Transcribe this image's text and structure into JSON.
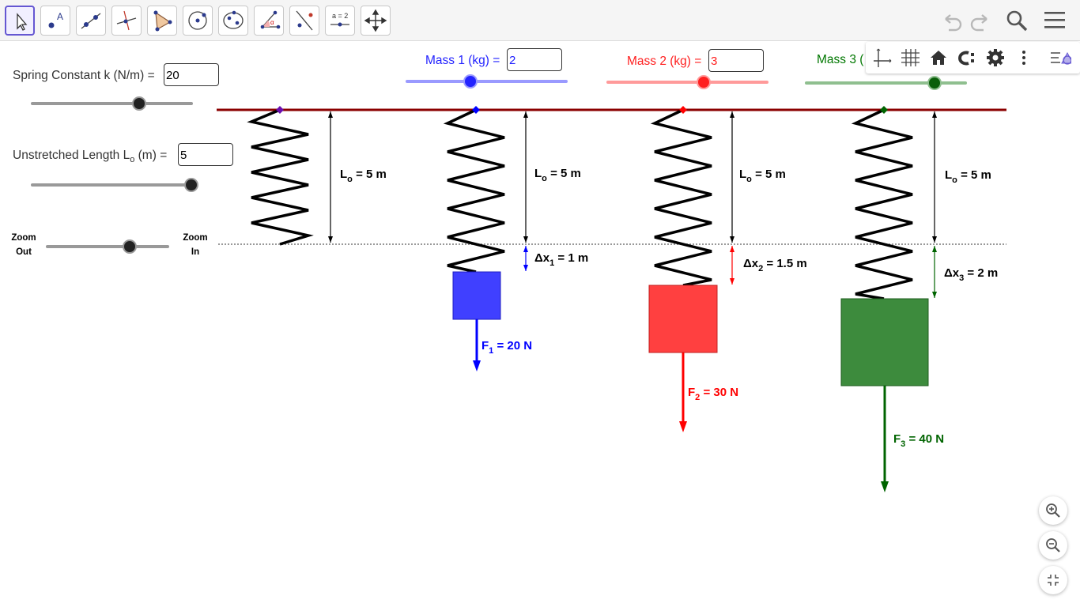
{
  "toolbar": {
    "tools": [
      {
        "name": "move-tool",
        "icon": "cursor-icon"
      },
      {
        "name": "point-tool",
        "icon": "point-icon"
      },
      {
        "name": "line-tool",
        "icon": "line-icon"
      },
      {
        "name": "perpendicular-line-tool",
        "icon": "perpendicular-icon"
      },
      {
        "name": "polygon-tool",
        "icon": "polygon-icon"
      },
      {
        "name": "circle-center-point-tool",
        "icon": "circle-icon"
      },
      {
        "name": "ellipse-tool",
        "icon": "ellipse-icon"
      },
      {
        "name": "angle-tool",
        "icon": "angle-icon"
      },
      {
        "name": "reflect-tool",
        "icon": "reflect-icon"
      },
      {
        "name": "slider-tool",
        "icon": "slider-icon",
        "label": "a = 2"
      },
      {
        "name": "move-graphics-view-tool",
        "icon": "move-view-icon"
      }
    ],
    "right_icons": [
      "undo-icon",
      "redo-icon",
      "search-icon",
      "menu-icon"
    ]
  },
  "controls": {
    "spring_constant": {
      "label": "Spring Constant k (N/m)",
      "eq": "=",
      "value": "20",
      "level": 0.67
    },
    "unstretched_length": {
      "label_main": "Unstretched Length L",
      "label_sub": "o",
      "label_unit": " (m)",
      "eq": "=",
      "value": "5",
      "level": 1.0
    },
    "zoom": {
      "out_line1": "Zoom",
      "out_line2": "Out",
      "in_line1": "Zoom",
      "in_line2": "In",
      "level": 0.68
    },
    "mass1": {
      "label": "Mass 1 (kg)",
      "eq": "=",
      "value": "2",
      "color": "#2323ff",
      "level": 0.4
    },
    "mass2": {
      "label": "Mass 2 (kg)",
      "eq": "=",
      "value": "3",
      "color": "#ff2020",
      "level": 0.6
    },
    "mass3": {
      "label": "Mass 3 (",
      "color": "#007700",
      "level": 0.8
    }
  },
  "graphics_bar": [
    "axes-icon",
    "grid-icon",
    "home-icon",
    "point-capture-icon",
    "settings-icon",
    "more-vert-icon",
    "style-bar-toggle-icon"
  ],
  "zoom_buttons": [
    "zoom-in-icon",
    "zoom-out-icon",
    "fullscreen-exit-icon"
  ],
  "scene": {
    "unstretched_labels": [
      "L",
      "o",
      " = 5 m"
    ],
    "springs": [
      {
        "id": "spring-0",
        "color": "#6a0dad"
      },
      {
        "id": "spring-1",
        "color": "#0000ff",
        "dx_label": "Δx",
        "dx_sub": "1",
        "dx_value": " =  1 m",
        "force_label": "F",
        "force_sub": "1",
        "force_value": " =  20 N"
      },
      {
        "id": "spring-2",
        "color": "#ff0000",
        "dx_label": "Δx",
        "dx_sub": "2",
        "dx_value": " =  1.5 m",
        "force_label": "F",
        "force_sub": "2",
        "force_value": " =  30 N"
      },
      {
        "id": "spring-3",
        "color": "#006400",
        "dx_label": "Δx",
        "dx_sub": "3",
        "dx_value": " = 2  m",
        "force_label": "F",
        "force_sub": "3",
        "force_value": " =  40 N"
      }
    ],
    "colors": {
      "ceiling": "#8b0000",
      "mass1": "#4040ff",
      "mass2": "#ff4040",
      "mass3": "#3d8b3d"
    }
  }
}
